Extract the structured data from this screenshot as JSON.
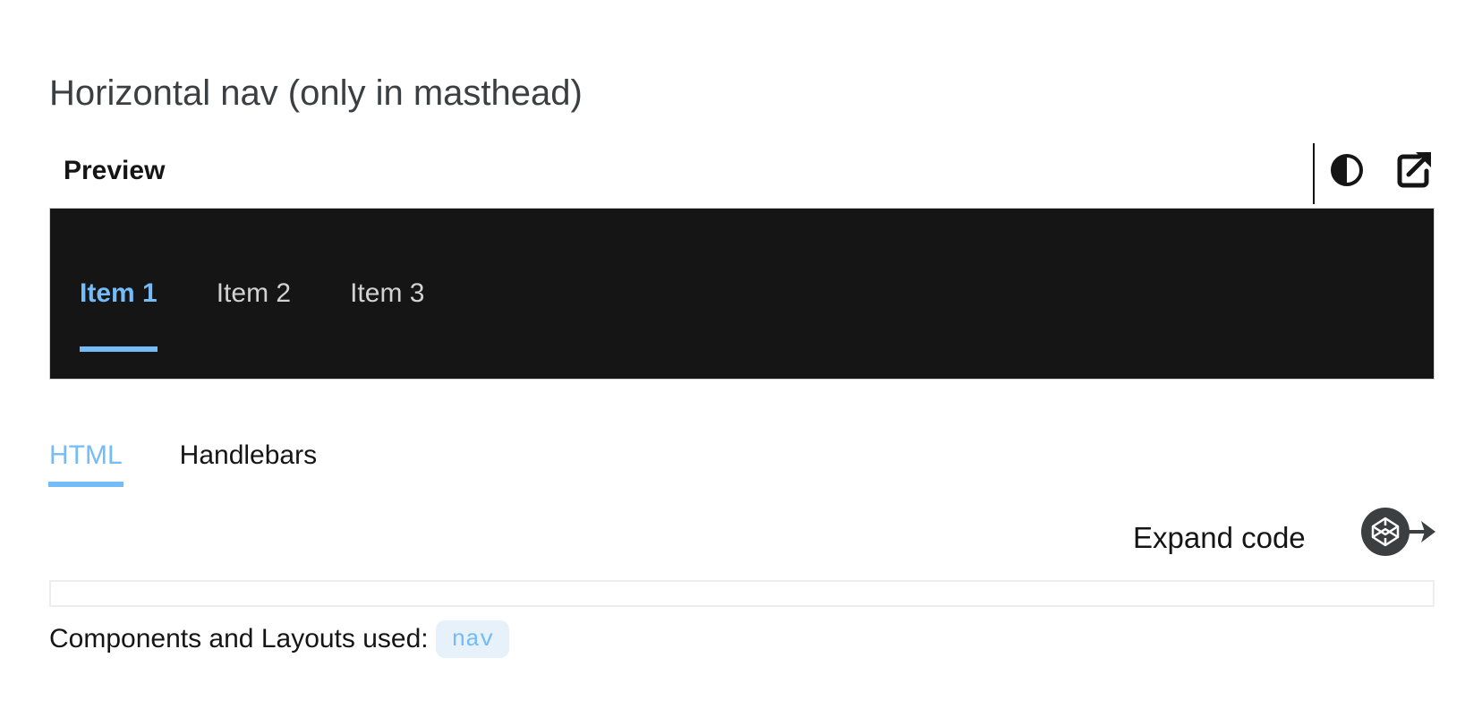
{
  "page": {
    "title": "Horizontal nav (only in masthead)"
  },
  "preview": {
    "label": "Preview",
    "icons": {
      "theme_toggle": "contrast-icon",
      "open_new_window": "external-link-icon"
    }
  },
  "nav": {
    "items": [
      {
        "label": "Item 1",
        "active": true
      },
      {
        "label": "Item 2",
        "active": false
      },
      {
        "label": "Item 3",
        "active": false
      }
    ]
  },
  "code_tabs": [
    {
      "label": "HTML",
      "active": true
    },
    {
      "label": "Handlebars",
      "active": false
    }
  ],
  "code_actions": {
    "expand_label": "Expand code",
    "codepen_icon": "codepen-icon"
  },
  "components": {
    "label": "Components and Layouts used:",
    "badges": [
      "nav"
    ]
  },
  "colors": {
    "accent": "#73bcf7",
    "preview_bg": "#151515",
    "nav_text": "#d2d2d2",
    "badge_bg": "#e7f1fa"
  }
}
